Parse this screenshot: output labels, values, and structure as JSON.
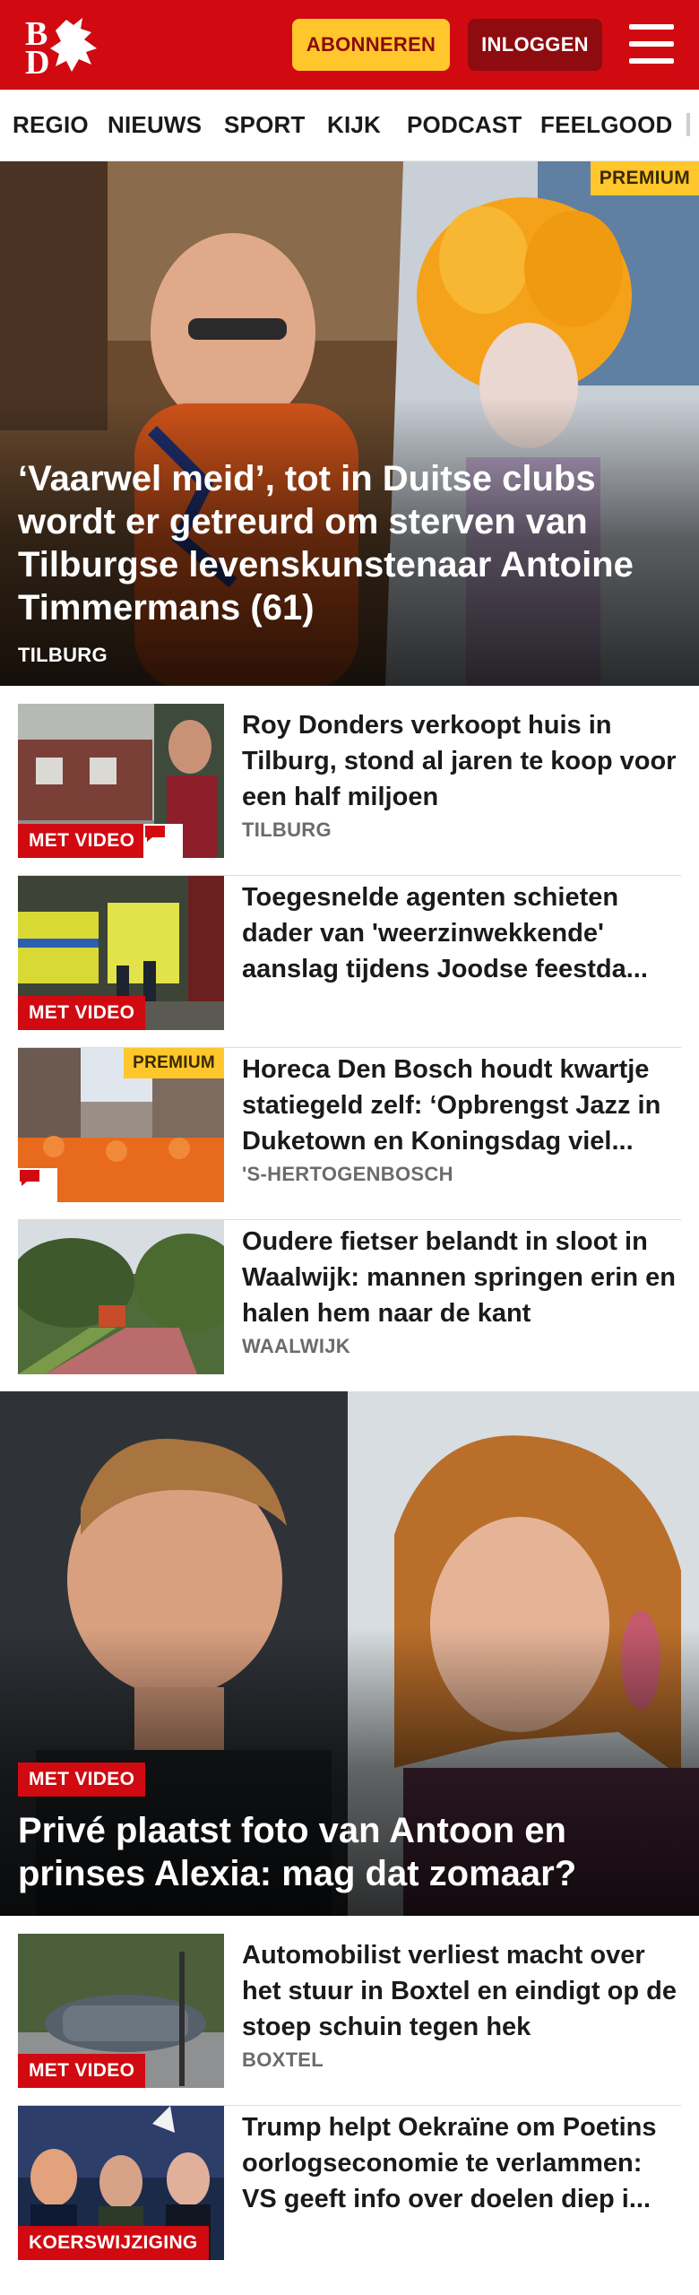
{
  "header": {
    "logo_text": "BD",
    "subscribe_label": "ABONNEREN",
    "login_label": "INLOGGEN",
    "menu_icon": "hamburger-menu-icon",
    "brand_color": "#d10a11",
    "accent_color": "#ffc72c"
  },
  "nav": {
    "items": [
      "REGIO",
      "NIEUWS",
      "SPORT",
      "KIJK",
      "PODCAST",
      "FEELGOOD"
    ]
  },
  "hero": {
    "badge": "PREMIUM",
    "title": "‘Vaarwel meid’, tot in Duitse clubs wordt er getreurd om sterven van Tilburgse levenskunstenaar Antoine Timmermans (61)",
    "location": "TILBURG"
  },
  "articles": [
    {
      "title": "Roy Donders verkoopt huis in Tilburg, stond al jaren te koop voor een half miljoen",
      "location": "TILBURG",
      "badge": "MET VIDEO",
      "comment_icon": "comment-icon"
    },
    {
      "title": "Toegesnelde agenten schieten dader van 'weerzinwekkende' aanslag tijdens Joodse feestda...",
      "location": "",
      "badge": "MET VIDEO"
    },
    {
      "title": "Horeca Den Bosch houdt kwartje statiegeld zelf: ‘Opbrengst Jazz in Duketown en Koningsdag viel...",
      "location": "'S-HERTOGENBOSCH",
      "badge": "PREMIUM",
      "comment_icon": "comment-icon"
    },
    {
      "title": "Oudere fietser belandt in sloot in Waalwijk: mannen springen erin en halen hem naar de kant",
      "location": "WAALWIJK"
    }
  ],
  "feature": {
    "badge": "MET VIDEO",
    "title": "Privé plaatst foto van Antoon en prinses Alexia: mag dat zomaar?"
  },
  "articles2": [
    {
      "title": "Automobilist verliest macht over het stuur in Boxtel en eindigt op de stoep schuin tegen hek",
      "location": "BOXTEL",
      "badge": "MET VIDEO"
    },
    {
      "title": "Trump helpt Oekraïne om Poetins oorlogseconomie te verlammen: VS geeft info over doelen diep i...",
      "location": "",
      "badge": "KOERSWIJZIGING"
    }
  ]
}
